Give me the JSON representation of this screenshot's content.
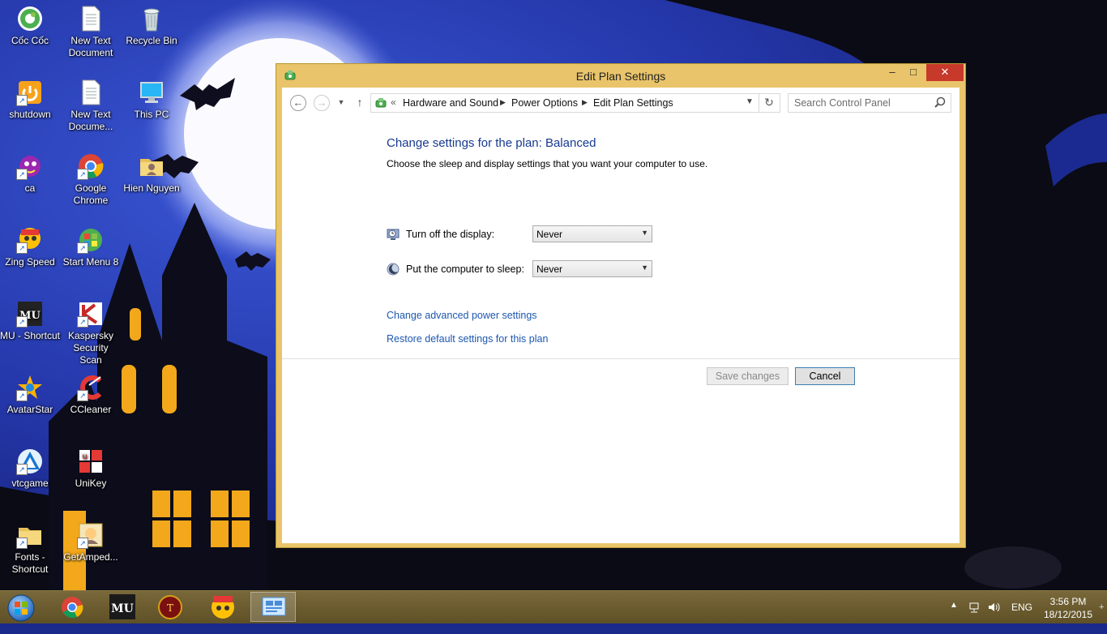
{
  "desktop": {
    "icons": [
      {
        "label": "Cốc Cốc"
      },
      {
        "label": "New Text Document"
      },
      {
        "label": "Recycle Bin"
      },
      {
        "label": "shutdown"
      },
      {
        "label": "New Text Docume..."
      },
      {
        "label": "This PC"
      },
      {
        "label": "ca"
      },
      {
        "label": "Google Chrome"
      },
      {
        "label": "Hien Nguyen"
      },
      {
        "label": "Zing Speed"
      },
      {
        "label": "Start Menu 8"
      },
      {
        "label": "MU - Shortcut"
      },
      {
        "label": "Kaspersky Security Scan"
      },
      {
        "label": "AvatarStar"
      },
      {
        "label": "CCleaner"
      },
      {
        "label": "vtcgame"
      },
      {
        "label": "UniKey"
      },
      {
        "label": "Fonts - Shortcut"
      },
      {
        "label": "GetAmped..."
      }
    ]
  },
  "window": {
    "title": "Edit Plan Settings",
    "controls": {
      "minimize": "–",
      "maximize": "□",
      "close": "✕"
    },
    "address": {
      "overflow": "«",
      "crumbs": [
        "Hardware and Sound",
        "Power Options",
        "Edit Plan Settings"
      ]
    },
    "search": {
      "placeholder": "Search Control Panel"
    },
    "content": {
      "title": "Change settings for the plan: Balanced",
      "subtitle": "Choose the sleep and display settings that you want your computer to use.",
      "display_label": "Turn off the display:",
      "display_value": "Never",
      "sleep_label": "Put the computer to sleep:",
      "sleep_value": "Never",
      "advanced_link": "Change advanced power settings",
      "restore_link": "Restore default settings for this plan",
      "save_label": "Save changes",
      "cancel_label": "Cancel"
    }
  },
  "taskbar": {
    "language": "ENG",
    "time": "3:56 PM",
    "date": "18/12/2015"
  },
  "colors": {
    "window_frame": "#e9c46a",
    "close_button": "#c7392b",
    "link": "#1d57b0",
    "heading": "#16398f"
  }
}
